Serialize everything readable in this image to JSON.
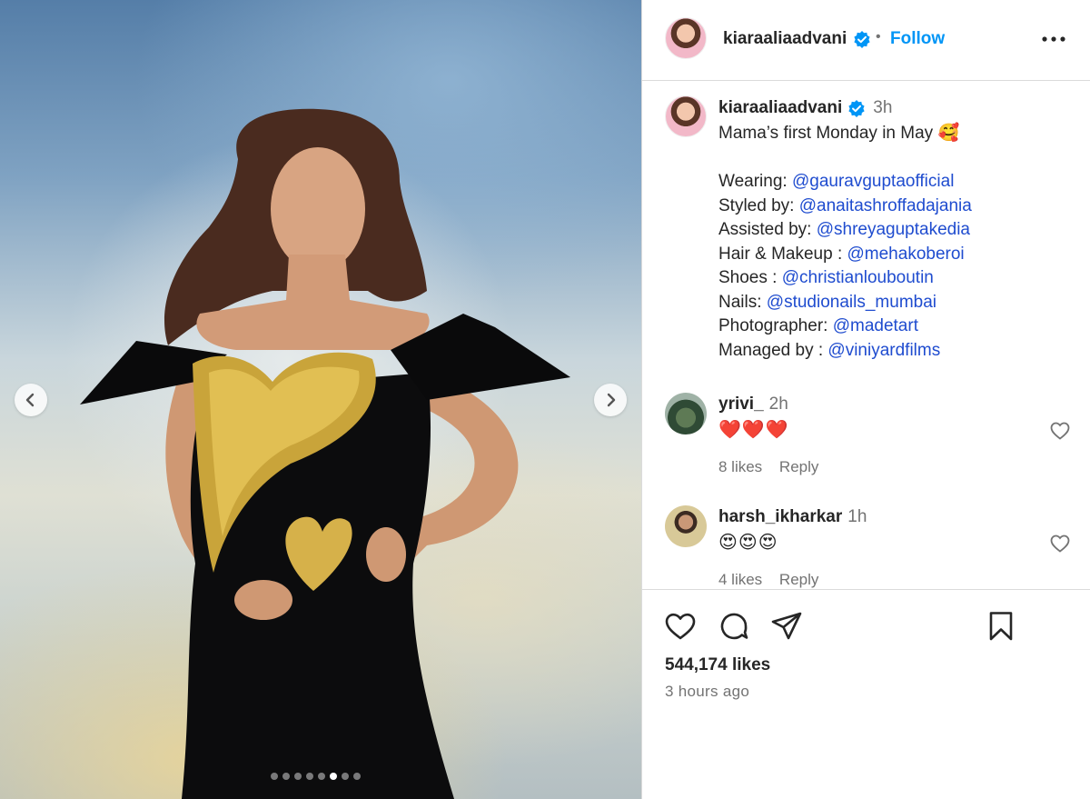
{
  "post": {
    "username": "kiaraaliaadvani",
    "follow_label": "Follow",
    "separator": "•",
    "media": {
      "slide_count": 8,
      "active_slide": 5
    }
  },
  "caption": {
    "username": "kiaraaliaadvani",
    "time": "3h",
    "first_line": "Mama’s first Monday in May 🥰",
    "credits": [
      {
        "label": "Wearing: ",
        "handle": "@gauravguptaofficial"
      },
      {
        "label": "Styled by: ",
        "handle": "@anaitashroffadajania"
      },
      {
        "label": "Assisted by: ",
        "handle": "@shreyaguptakedia"
      },
      {
        "label": "Hair & Makeup : ",
        "handle": "@mehakoberoi"
      },
      {
        "label": "Shoes : ",
        "handle": "@christianlouboutin"
      },
      {
        "label": "Nails: ",
        "handle": "@studionails_mumbai"
      },
      {
        "label": "Photographer: ",
        "handle": "@madetart"
      },
      {
        "label": "Managed by : ",
        "handle": "@viniyardfilms"
      }
    ]
  },
  "comments": [
    {
      "username": "yrivi_",
      "time": "2h",
      "text": "❤️❤️❤️",
      "likes": "8 likes",
      "reply": "Reply"
    },
    {
      "username": "harsh_ikharkar",
      "time": "1h",
      "text": "😍😍😍",
      "likes": "4 likes",
      "reply": "Reply"
    }
  ],
  "footer": {
    "likes": "544,174 likes",
    "time_ago": "3 hours ago"
  },
  "icons": {
    "verified": "verified-badge-icon",
    "more": "more-options-icon",
    "like": "heart-icon",
    "comment": "comment-bubble-icon",
    "share": "paper-plane-icon",
    "save": "bookmark-icon",
    "prev": "chevron-left-icon",
    "next": "chevron-right-icon"
  },
  "colors": {
    "link": "#1f4ccf",
    "follow": "#0095f6",
    "verified": "#0095f6",
    "muted": "#737373"
  }
}
